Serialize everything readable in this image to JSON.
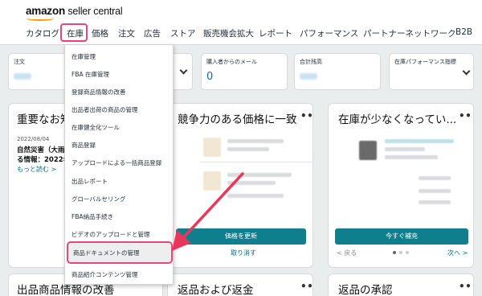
{
  "header": {
    "logo_brand": "amazon",
    "logo_rest": " seller central"
  },
  "nav": {
    "items": [
      "カタログ",
      "在庫",
      "価格",
      "注文",
      "広告",
      "ストア",
      "販売機会拡大",
      "レポート",
      "パフォーマンス",
      "パートナーネットワーク",
      "B2B"
    ],
    "active": "在庫"
  },
  "dropdown": {
    "items": [
      "在庫管理",
      "FBA 在庫管理",
      "登録商品情報の改善",
      "出品者出荷の商品の管理",
      "在庫健全化ツール",
      "商品登録",
      "アップロードによる一括商品登録",
      "出品レポート",
      "グローバルセリング",
      "FBA納品手続き",
      "ビデオのアップロードと管理",
      "商品ドキュメントの管理",
      "商品紹介コンテンツ管理"
    ],
    "highlighted": "商品ドキュメントの管理",
    "accent_color": "#e8457c"
  },
  "metrics": [
    {
      "label": "注文",
      "value": ""
    },
    {
      "label": "購入者からのメール",
      "value": "0"
    },
    {
      "label": "合計残高",
      "value": ""
    },
    {
      "label": "在庫パフォーマンス指標",
      "value": ""
    }
  ],
  "cards": {
    "news": {
      "title": "重要なお知",
      "date": "2022/08/04",
      "headline_1": "自然災害（大雨",
      "headline_2": "る情報：2022年",
      "more": "もっと読む >"
    },
    "price": {
      "title": "競争力のある価格に一致",
      "button": "価格を更新",
      "cancel": "取り消す"
    },
    "low_stock": {
      "title": "在庫が少なくなってい...",
      "button": "今すぐ補充",
      "prev": "< 戻る",
      "next": "次へ >"
    },
    "listing": {
      "title": "出品商品情報の改善"
    },
    "returns": {
      "title": "返品および返金"
    },
    "approval": {
      "title": "返品の承認"
    }
  },
  "menu_dots": "•••",
  "arrow_color": "#e8375a"
}
